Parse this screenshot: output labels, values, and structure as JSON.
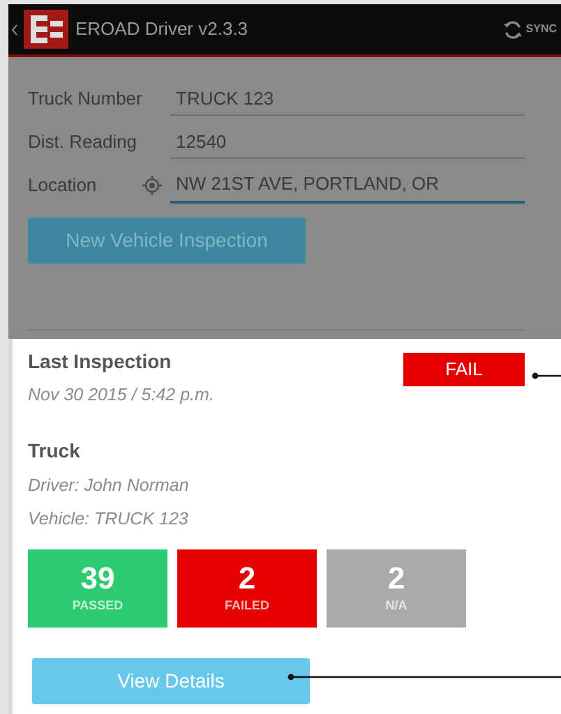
{
  "app_bar": {
    "title": "EROAD Driver v2.3.3",
    "sync_label": "SYNC"
  },
  "form": {
    "fields": [
      {
        "label": "Truck Number",
        "value": "TRUCK 123",
        "focused": false,
        "kind": "text"
      },
      {
        "label": "Dist. Reading",
        "value": "12540",
        "focused": false,
        "kind": "text"
      },
      {
        "label": "Location",
        "value": "NW 21ST AVE, PORTLAND, OR",
        "focused": true,
        "kind": "location"
      }
    ],
    "button": "New Vehicle Inspection"
  },
  "last_inspection": {
    "title": "Last Inspection",
    "date": "Nov 30 2015 / 5:42 p.m.",
    "result": "FAIL"
  },
  "vehicle": {
    "title": "Truck",
    "driver": "Driver: John Norman",
    "vehicle": "Vehicle: TRUCK 123"
  },
  "stats": [
    {
      "count": "39",
      "label": "PASSED",
      "color": "#2ecc71"
    },
    {
      "count": "2",
      "label": "FAILED",
      "color": "#e60000"
    },
    {
      "count": "2",
      "label": "N/A",
      "color": "#aaaaaa"
    }
  ],
  "details_button": "View Details"
}
